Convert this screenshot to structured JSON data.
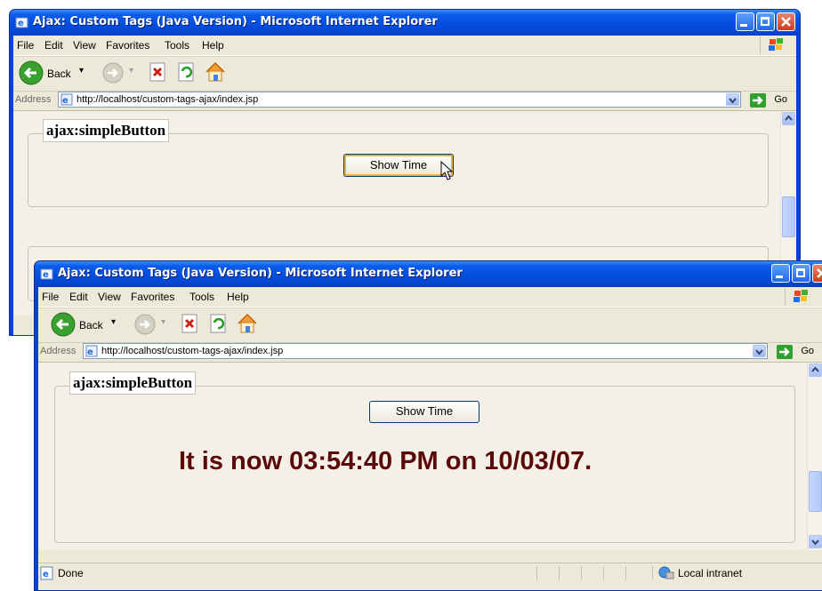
{
  "window_title": "Ajax: Custom Tags (Java Version) - Microsoft Internet Explorer",
  "menu": [
    "File",
    "Edit",
    "View",
    "Favorites",
    "Tools",
    "Help"
  ],
  "toolbar": {
    "back_label": "Back"
  },
  "address": {
    "label": "Address",
    "url": "http://localhost/custom-tags-ajax/index.jsp",
    "go_label": "Go"
  },
  "legend": "ajax:simpleButton",
  "button_label": "Show Time",
  "result_text": "It is now 03:54:40 PM on 10/03/07.",
  "status": {
    "text": "Done",
    "zone": "Local intranet"
  },
  "colors": {
    "titlebar": "#0450e0",
    "content_bg": "#f5f0e7",
    "result_text": "#5a0808"
  }
}
